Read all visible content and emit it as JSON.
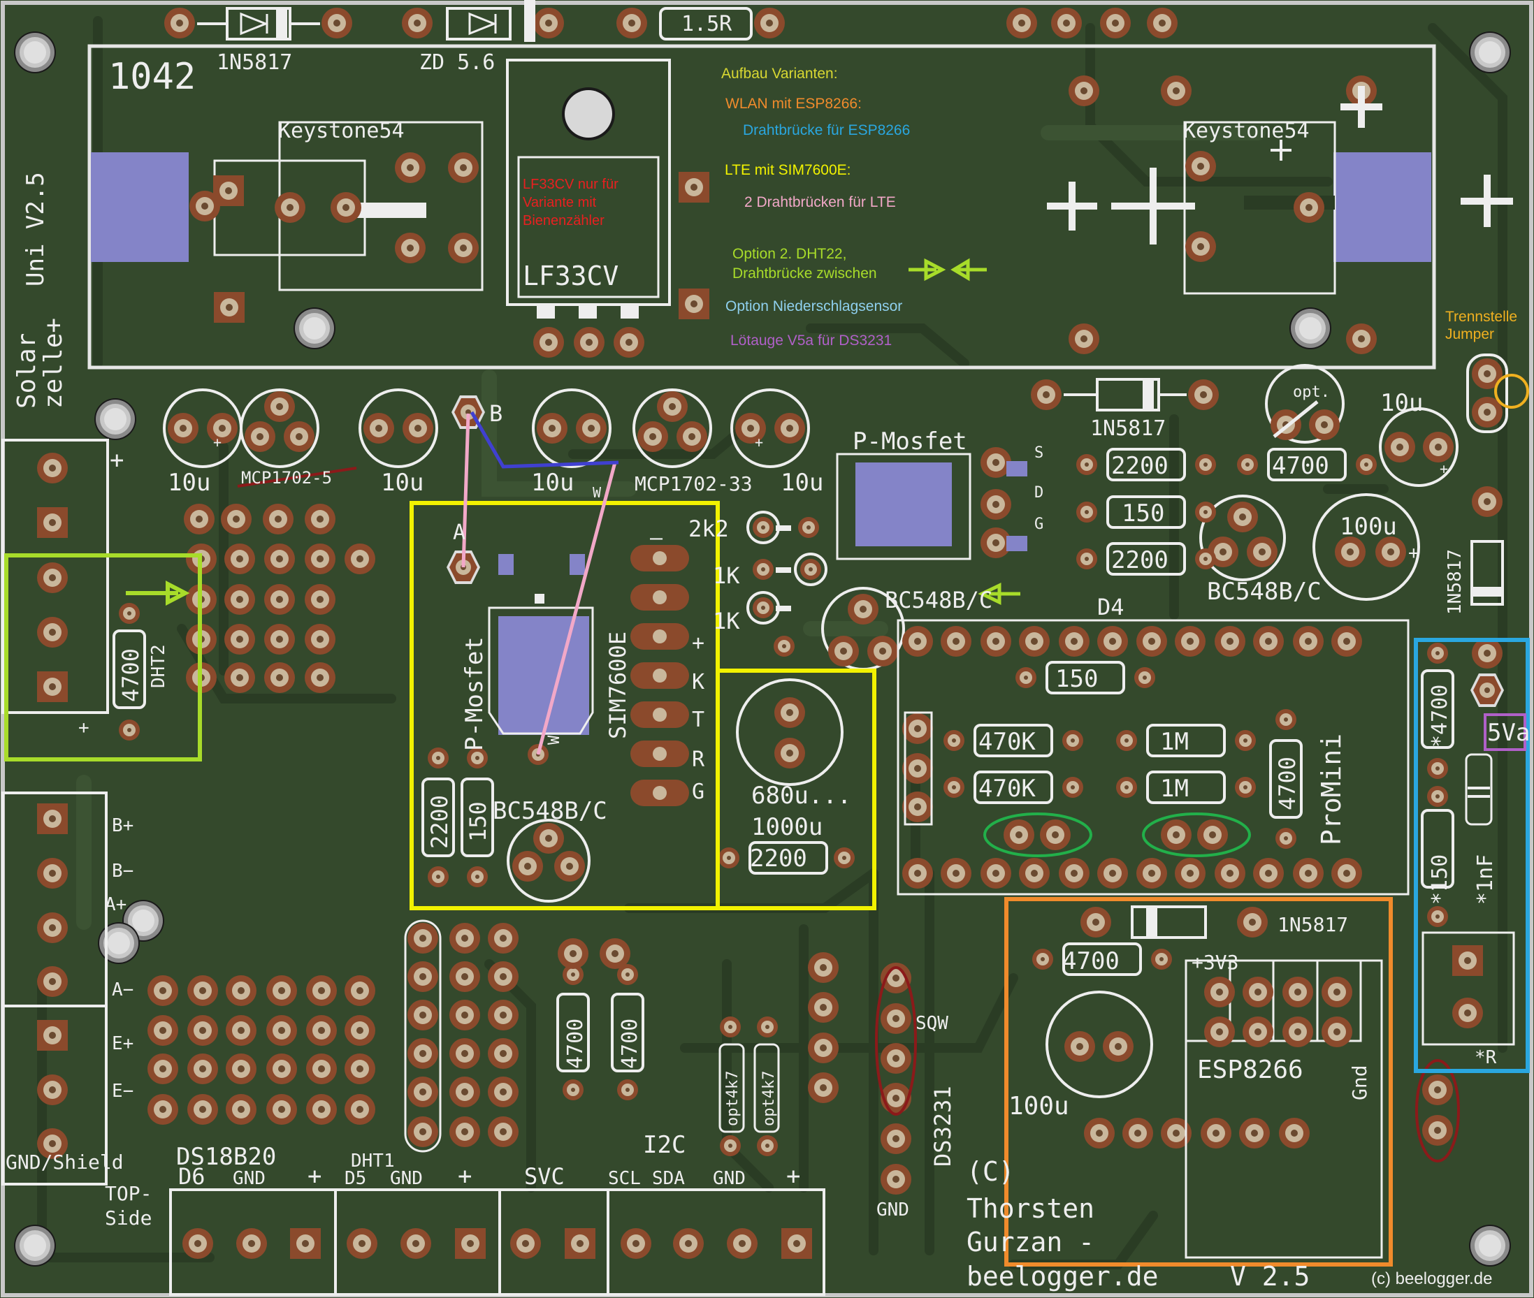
{
  "board": {
    "bg_color": "#34492c",
    "copper_color": "#3b5231",
    "pad_color": "#c2b39b",
    "pad_dark": "#8b4a2c",
    "label_color": "#eeeeee",
    "blue_pad": "#8484c8"
  },
  "silkscreen": {
    "board_no": "1042",
    "version": "Uni  V2.5",
    "solar": "Solar",
    "zelle": "zelle+",
    "d_1n5817_top": "1N5817",
    "zd": "ZD 5.6",
    "r_1_5r": "1.5R",
    "keystone_left": "Keystone54",
    "keystone_right": "Keystone54",
    "lf33cv": "LF33CV",
    "cap_10u_1": "10u",
    "mcp_5": "MCP1702-5",
    "cap_10u_2": "10u",
    "cap_10u_3": "10u",
    "mcp_33": "MCP1702-33",
    "cap_10u_4": "10u",
    "pin_b": "B",
    "pin_a": "A",
    "pin_w1": "W",
    "pin_w2": "W",
    "pmosfet_right": "P-Mosfet",
    "pin_s": "S",
    "pin_d": "D",
    "pin_g": "G",
    "d_1n5817_mid": "1N5817",
    "opt": "opt.",
    "cap_10u_5": "10u",
    "r_2200_a": "2200",
    "r_4700_a": "4700",
    "r_150_a": "150",
    "r_2200_b": "2200",
    "cap_100u_r": "100u",
    "bc548_right": "BC548B/C",
    "d_1n5817_vert": "1N5817",
    "r_2k2": "2k2",
    "r_1k_a": "1K",
    "r_1k_b": "1K",
    "bc548_mid": "BC548B/C",
    "d4": "D4",
    "r_150_b": "150",
    "r_470k_a": "470K",
    "r_470k_b": "470K",
    "r_1m_a": "1M",
    "r_1m_b": "1M",
    "r_4700_b": "4700",
    "promini": "ProMini",
    "r_4700_dht2": "4700",
    "dht2": "DHT2",
    "plus_dht": "+",
    "pmosfet_left": "P-Mosfet",
    "sim": "SIM7600E",
    "sim_pins": [
      "—",
      "+",
      "K",
      "T",
      "R",
      "G"
    ],
    "r_2200_c": "2200",
    "r_150_c": "150",
    "bc548_left": "BC548B/C",
    "cap_680": "680u...",
    "cap_1000": "1000u",
    "r_2200_d": "2200",
    "bat_labels": [
      "B+",
      "B−",
      "A+",
      "A−",
      "E+",
      "E−"
    ],
    "gnd_shield": "GND/Shield",
    "top_side_1": "TOP-",
    "top_side_2": "Side",
    "ds18b20": "DS18B20",
    "d6": "D6",
    "gnd_1": "GND",
    "plus_1": "+",
    "dht1": "DHT1",
    "d5": "D5",
    "gnd_2": "GND",
    "plus_2": "+",
    "svc": "SVC",
    "i2c": "I2C",
    "scl": "SCL",
    "sda": "SDA",
    "gnd_3": "GND",
    "plus_3": "+",
    "r_4700_c": "4700",
    "r_4700_d": "4700",
    "opt4k7_a": "opt4k7",
    "opt4k7_b": "opt4k7",
    "sqw": "SQW",
    "ds3231": "DS3231",
    "gnd_rtc": "GND",
    "copyright_1": "(C)",
    "copyright_2": "Thorsten",
    "copyright_3": "Gurzan -",
    "copyright_4": "beelogger.de",
    "version_bottom": "V 2.5",
    "d_1n5817_esp": "1N5817",
    "r_4700_esp": "4700",
    "v3v3": "+3V3",
    "cap_100u_esp": "100u",
    "esp": "ESP8266",
    "gnd_esp": "Gnd",
    "r_4700_e": "*4700",
    "v5a": "5Va",
    "r_150_e": "*150",
    "cap_1nf": "*1nF",
    "r_star": "*R"
  },
  "annotations": {
    "title": "Aufbau Varianten:",
    "wlan": "WLAN mit ESP8266:",
    "wlan_detail": "Drahtbrücke für ESP8266",
    "lte": "LTE mit SIM7600E:",
    "lte_detail": "2 Drahtbrücken für LTE",
    "dht_1": "Option 2. DHT22,",
    "dht_2": "Drahtbrücke zwischen",
    "rain": "Option Niederschlagsensor",
    "v5a_note": "Lötauge V5a für DS3231",
    "lf_1": "LF33CV nur für",
    "lf_2": "Variante mit",
    "lf_3": "Bienenzähler",
    "jumper_1": "Trennstelle",
    "jumper_2": "Jumper",
    "credit": "(c) beelogger.de",
    "colors": {
      "title": "#d8d832",
      "wlan": "#f08b2c",
      "wlan_detail": "#2aa7e0",
      "lte": "#f2f200",
      "lte_detail": "#f2a8c8",
      "dht": "#a8dc2a",
      "rain": "#8fd0ee",
      "v5a": "#b060c8",
      "lf": "#e82020",
      "jumper": "#f0b020",
      "credit": "#eeeeee"
    }
  }
}
